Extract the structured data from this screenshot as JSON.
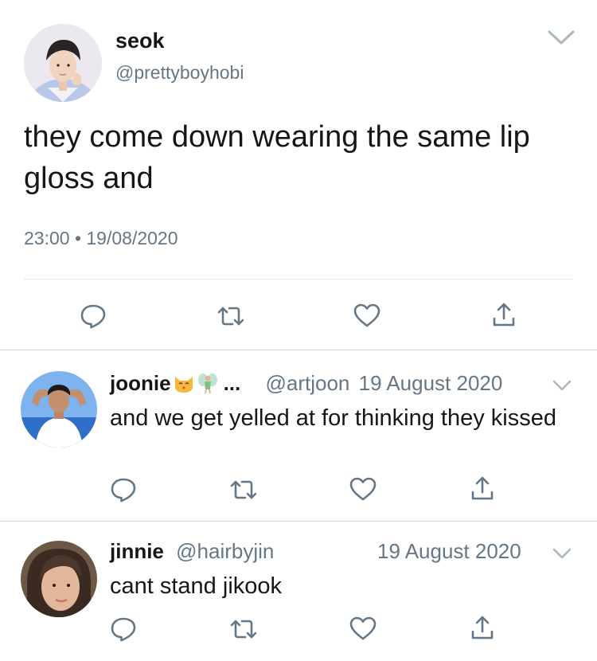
{
  "main": {
    "name": "seok",
    "handle": "@prettyboyhobi",
    "text": "they come down wearing the same lip gloss and",
    "meta": "23:00 • 19/08/2020"
  },
  "replies": [
    {
      "name": "joonie",
      "name_suffix": "...",
      "handle": "@artjoon",
      "date": "19 August 2020",
      "text": "and we get yelled at for thinking they kissed"
    },
    {
      "name": "jinnie",
      "handle": "@hairbyjin",
      "date": "19 August 2020",
      "text": "cant stand jikook"
    }
  ],
  "icons": {
    "reply": "reply-icon",
    "retweet": "retweet-icon",
    "like": "heart-icon",
    "share": "share-icon",
    "more": "chevron-down-icon"
  },
  "colors": {
    "text": "#14171a",
    "secondary": "#657786",
    "icon": "#657786",
    "divider": "#dfe3e6"
  }
}
